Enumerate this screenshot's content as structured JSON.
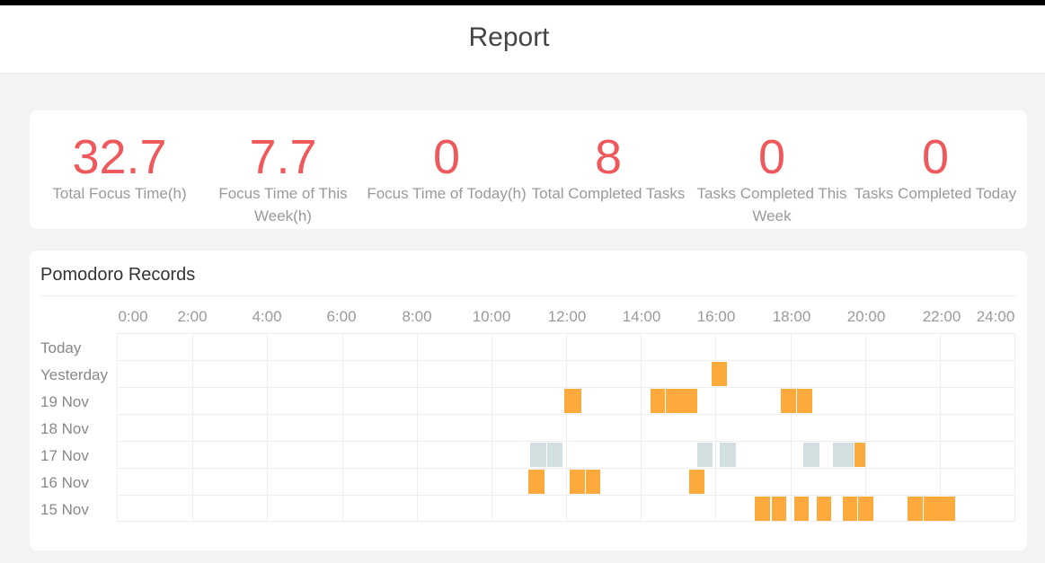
{
  "header": {
    "title": "Report"
  },
  "stats": [
    {
      "value": "32.7",
      "label": "Total Focus Time(h)"
    },
    {
      "value": "7.7",
      "label": "Focus Time of This Week(h)"
    },
    {
      "value": "0",
      "label": "Focus Time of Today(h)"
    },
    {
      "value": "8",
      "label": "Total Completed Tasks"
    },
    {
      "value": "0",
      "label": "Tasks Completed This Week"
    },
    {
      "value": "0",
      "label": "Tasks Completed Today"
    }
  ],
  "records": {
    "title": "Pomodoro Records",
    "hours": [
      "0:00",
      "2:00",
      "4:00",
      "6:00",
      "8:00",
      "10:00",
      "12:00",
      "14:00",
      "16:00",
      "18:00",
      "20:00",
      "22:00",
      "24:00"
    ],
    "days": [
      "Today",
      "Yesterday",
      "19 Nov",
      "18 Nov",
      "17 Nov",
      "16 Nov",
      "15 Nov"
    ],
    "colors": {
      "completed": "#fcaa3c",
      "interrupted": "#d2dfe1"
    },
    "sessions": [
      {
        "day": 1,
        "start": 15.9,
        "end": 16.3,
        "status": "completed"
      },
      {
        "day": 2,
        "start": 11.95,
        "end": 12.4,
        "status": "completed"
      },
      {
        "day": 2,
        "start": 14.25,
        "end": 14.65,
        "status": "completed"
      },
      {
        "day": 2,
        "start": 14.67,
        "end": 15.07,
        "status": "completed"
      },
      {
        "day": 2,
        "start": 15.09,
        "end": 15.5,
        "status": "completed"
      },
      {
        "day": 2,
        "start": 17.75,
        "end": 18.15,
        "status": "completed"
      },
      {
        "day": 2,
        "start": 18.17,
        "end": 18.58,
        "status": "completed"
      },
      {
        "day": 4,
        "start": 11.05,
        "end": 11.47,
        "status": "interrupted"
      },
      {
        "day": 4,
        "start": 11.49,
        "end": 11.9,
        "status": "interrupted"
      },
      {
        "day": 4,
        "start": 15.52,
        "end": 15.92,
        "status": "interrupted"
      },
      {
        "day": 4,
        "start": 16.12,
        "end": 16.55,
        "status": "interrupted"
      },
      {
        "day": 4,
        "start": 18.35,
        "end": 18.78,
        "status": "interrupted"
      },
      {
        "day": 4,
        "start": 19.15,
        "end": 19.7,
        "status": "interrupted"
      },
      {
        "day": 4,
        "start": 19.72,
        "end": 20.0,
        "status": "completed"
      },
      {
        "day": 5,
        "start": 11.0,
        "end": 11.42,
        "status": "completed"
      },
      {
        "day": 5,
        "start": 12.1,
        "end": 12.5,
        "status": "completed"
      },
      {
        "day": 5,
        "start": 12.52,
        "end": 12.92,
        "status": "completed"
      },
      {
        "day": 5,
        "start": 15.3,
        "end": 15.7,
        "status": "completed"
      },
      {
        "day": 6,
        "start": 17.05,
        "end": 17.45,
        "status": "completed"
      },
      {
        "day": 6,
        "start": 17.5,
        "end": 17.9,
        "status": "completed"
      },
      {
        "day": 6,
        "start": 18.1,
        "end": 18.5,
        "status": "completed"
      },
      {
        "day": 6,
        "start": 18.7,
        "end": 19.1,
        "status": "completed"
      },
      {
        "day": 6,
        "start": 19.4,
        "end": 19.8,
        "status": "completed"
      },
      {
        "day": 6,
        "start": 19.82,
        "end": 20.22,
        "status": "completed"
      },
      {
        "day": 6,
        "start": 21.15,
        "end": 21.55,
        "status": "completed"
      },
      {
        "day": 6,
        "start": 21.57,
        "end": 21.97,
        "status": "completed"
      },
      {
        "day": 6,
        "start": 21.99,
        "end": 22.42,
        "status": "completed"
      }
    ]
  }
}
